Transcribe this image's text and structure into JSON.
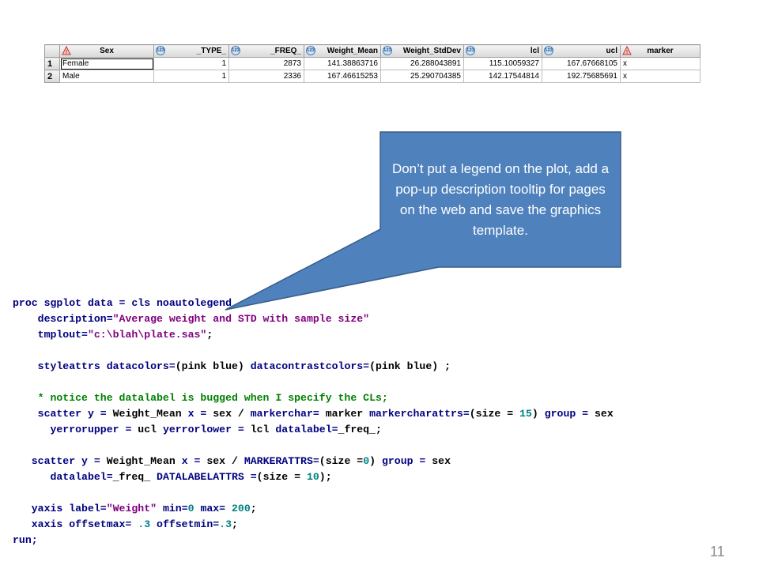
{
  "table": {
    "columns": [
      {
        "label": "Sex",
        "icon": "warning-icon"
      },
      {
        "label": "_TYPE_",
        "icon": "numeric-icon"
      },
      {
        "label": "_FREQ_",
        "icon": "numeric-icon"
      },
      {
        "label": "Weight_Mean",
        "icon": "numeric-icon"
      },
      {
        "label": "Weight_StdDev",
        "icon": "numeric-icon"
      },
      {
        "label": "lcl",
        "icon": "numeric-icon"
      },
      {
        "label": "ucl",
        "icon": "numeric-icon"
      },
      {
        "label": "marker",
        "icon": "warning-icon"
      }
    ],
    "rows": [
      {
        "num": "1",
        "cells": [
          "Female",
          "1",
          "2873",
          "141.38863716",
          "26.288043891",
          "115.10059327",
          "167.67668105",
          "x"
        ]
      },
      {
        "num": "2",
        "cells": [
          "Male",
          "1",
          "2336",
          "167.46615253",
          "25.290704385",
          "142.17544814",
          "192.75685691",
          "x"
        ]
      }
    ]
  },
  "callout": {
    "text": "Don’t put a legend on the plot, add a pop-up description tooltip for pages on the web and save the graphics template.",
    "fill_color": "#4f81bd",
    "border_color": "#385d8a"
  },
  "code": [
    [
      {
        "t": "proc sgplot data = cls noautolegend",
        "c": "kw"
      }
    ],
    [
      {
        "t": "    description=",
        "c": "kw"
      },
      {
        "t": "\"Average weight and STD with sample size\"",
        "c": "str"
      }
    ],
    [
      {
        "t": "    tmplout=",
        "c": "kw"
      },
      {
        "t": "\"c:\\blah\\plate.sas\"",
        "c": "str"
      },
      {
        "t": ";",
        "c": "plain"
      }
    ],
    [],
    [
      {
        "t": "    styleattrs datacolors=",
        "c": "kw"
      },
      {
        "t": "(pink blue) ",
        "c": "plain"
      },
      {
        "t": "datacontrastcolors=",
        "c": "kw"
      },
      {
        "t": "(pink blue) ;",
        "c": "plain"
      }
    ],
    [],
    [
      {
        "t": "    * notice the datalabel is bugged when I specify the CLs;",
        "c": "cmt"
      }
    ],
    [
      {
        "t": "    scatter y = ",
        "c": "kw"
      },
      {
        "t": "Weight_Mean ",
        "c": "plain"
      },
      {
        "t": "x = ",
        "c": "kw"
      },
      {
        "t": "sex / ",
        "c": "plain"
      },
      {
        "t": "markerchar= ",
        "c": "kw"
      },
      {
        "t": "marker ",
        "c": "plain"
      },
      {
        "t": "markercharattrs=",
        "c": "kw"
      },
      {
        "t": "(size = ",
        "c": "plain"
      },
      {
        "t": "15",
        "c": "num"
      },
      {
        "t": ") ",
        "c": "plain"
      },
      {
        "t": "group = ",
        "c": "kw"
      },
      {
        "t": "sex",
        "c": "plain"
      }
    ],
    [
      {
        "t": "      yerrorupper = ",
        "c": "kw"
      },
      {
        "t": "ucl ",
        "c": "plain"
      },
      {
        "t": "yerrorlower = ",
        "c": "kw"
      },
      {
        "t": "lcl ",
        "c": "plain"
      },
      {
        "t": "datalabel=",
        "c": "kw"
      },
      {
        "t": "_freq_;",
        "c": "plain"
      }
    ],
    [],
    [
      {
        "t": "   scatter y = ",
        "c": "kw"
      },
      {
        "t": "Weight_Mean ",
        "c": "plain"
      },
      {
        "t": "x = ",
        "c": "kw"
      },
      {
        "t": "sex / ",
        "c": "plain"
      },
      {
        "t": "MARKERATTRS=",
        "c": "kw"
      },
      {
        "t": "(size =",
        "c": "plain"
      },
      {
        "t": "0",
        "c": "num"
      },
      {
        "t": ") ",
        "c": "plain"
      },
      {
        "t": "group = ",
        "c": "kw"
      },
      {
        "t": "sex",
        "c": "plain"
      }
    ],
    [
      {
        "t": "      datalabel=",
        "c": "kw"
      },
      {
        "t": "_freq_ ",
        "c": "plain"
      },
      {
        "t": "DATALABELATTRS =",
        "c": "kw"
      },
      {
        "t": "(size = ",
        "c": "plain"
      },
      {
        "t": "10",
        "c": "num"
      },
      {
        "t": ");",
        "c": "plain"
      }
    ],
    [],
    [
      {
        "t": "   yaxis label=",
        "c": "kw"
      },
      {
        "t": "\"Weight\" ",
        "c": "str"
      },
      {
        "t": "min=",
        "c": "kw"
      },
      {
        "t": "0 ",
        "c": "num"
      },
      {
        "t": "max= ",
        "c": "kw"
      },
      {
        "t": "200",
        "c": "num"
      },
      {
        "t": ";",
        "c": "plain"
      }
    ],
    [
      {
        "t": "   xaxis offsetmax= ",
        "c": "kw"
      },
      {
        "t": ".3 ",
        "c": "num"
      },
      {
        "t": "offsetmin=",
        "c": "kw"
      },
      {
        "t": ".3",
        "c": "num"
      },
      {
        "t": ";",
        "c": "plain"
      }
    ],
    [
      {
        "t": "run;",
        "c": "kw"
      }
    ]
  ],
  "page_number": "11"
}
